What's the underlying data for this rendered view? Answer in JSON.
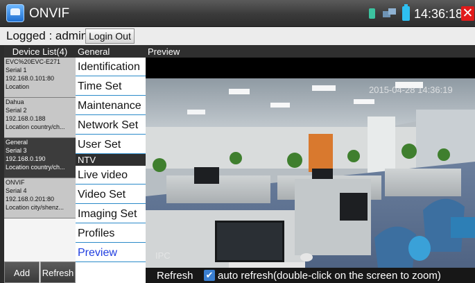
{
  "app": {
    "title": "ONVIF",
    "time": "14:36:18",
    "icon": "onvif-app-icon"
  },
  "status": {
    "icons": [
      "signal-icon",
      "network-icon",
      "battery-icon",
      "close-icon"
    ]
  },
  "login": {
    "status_text": "Logged : admin",
    "logout_label": "Login Out"
  },
  "device_list": {
    "header": "Device List(4)",
    "devices": [
      {
        "line1": "EVC%20EVC-E271",
        "line2": "Serial 1",
        "line3": "192.168.0.101:80",
        "line4": "Location"
      },
      {
        "line1": "Dahua",
        "line2": "Serial 2",
        "line3": "192.168.0.188",
        "line4": "Location country/ch..."
      },
      {
        "line1": "General",
        "line2": "Serial 3",
        "line3": "192.168.0.190",
        "line4": "Location country/ch..."
      },
      {
        "line1": "ONVIF",
        "line2": "Serial 4",
        "line3": "192.168.0.201:80",
        "line4": "Location city/shenz..."
      }
    ],
    "add_label": "Add",
    "refresh_label": "Refresh"
  },
  "menu": {
    "general_header": "General",
    "general_items": [
      "Identification",
      "Time Set",
      "Maintenance",
      "Network Set",
      "User Set"
    ],
    "ntv_header": "NTV",
    "ntv_items": [
      "Live video",
      "Video Set",
      "Imaging Set",
      "Profiles",
      "Preview"
    ],
    "active_item": "Preview"
  },
  "preview": {
    "header": "Preview",
    "timestamp": "2015-04-28 14:36:19",
    "watermark": "IPC",
    "refresh_label": "Refresh",
    "auto_refresh_label": "auto refresh(double-click on the screen to zoom)",
    "auto_refresh_checked": true
  }
}
